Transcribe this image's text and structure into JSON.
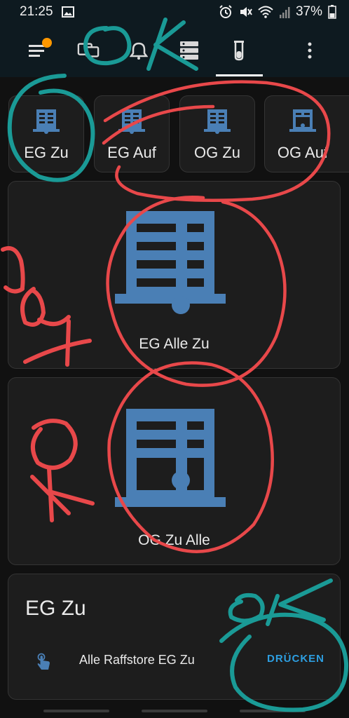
{
  "status": {
    "time": "21:25",
    "battery": "37%",
    "icons": [
      "gallery-icon",
      "alarm-icon",
      "mute-icon",
      "wifi-icon",
      "signal-icon",
      "battery-icon"
    ]
  },
  "appbar": {
    "tabs": [
      "menu-icon",
      "devices-icon",
      "bell-icon",
      "server-icon",
      "flask-icon"
    ],
    "active_tab": "flask-icon",
    "more": "more-vert-icon",
    "badge_color": "#ff9800"
  },
  "tiles": [
    {
      "label": "EG Zu",
      "icon": "blind-closed-icon"
    },
    {
      "label": "EG Auf",
      "icon": "blind-closed-icon"
    },
    {
      "label": "OG Zu",
      "icon": "blind-closed-icon"
    },
    {
      "label": "OG Auf",
      "icon": "blind-open-icon"
    }
  ],
  "big_buttons": [
    {
      "label": "EG Alle Zu",
      "icon": "blind-closed-icon"
    },
    {
      "label": "OG Zu Alle",
      "icon": "blind-open-icon"
    }
  ],
  "entity_card": {
    "title": "EG Zu",
    "entity_name": "Alle Raffstore EG Zu",
    "entity_icon": "gesture-tap-icon",
    "action_label": "DRÜCKEN"
  },
  "annotations": {
    "ok_top": "OK",
    "not_ok": "not ok",
    "ok_bottom": "OK",
    "red_color": "#e8484a",
    "teal_color": "#1a9a96"
  },
  "colors": {
    "icon_blue": "#4a7fb5",
    "accent_blue": "#2d9ee0",
    "card_bg": "#1d1d1d",
    "header_bg": "#0e1a20"
  }
}
